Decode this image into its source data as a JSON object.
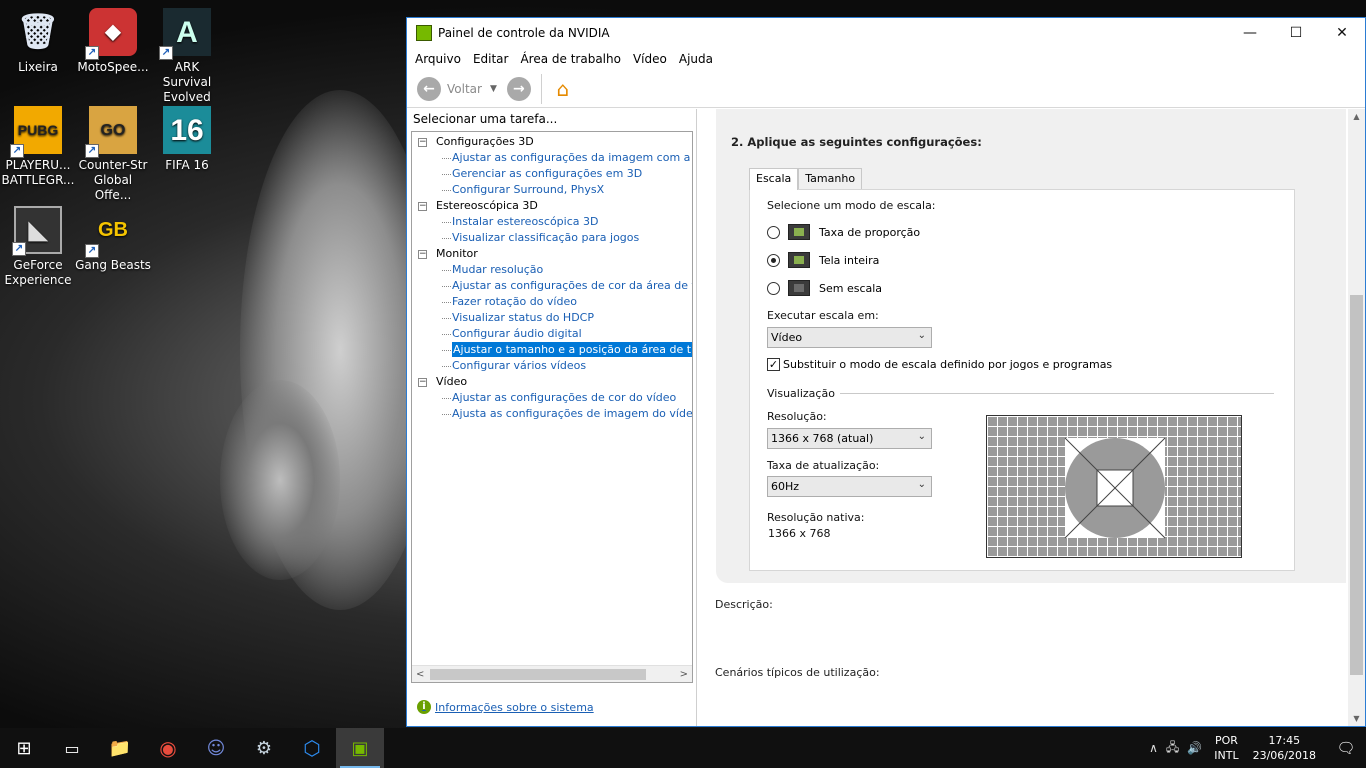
{
  "desktop": {
    "icons": [
      {
        "label": "Lixeira",
        "glyph": "🗑",
        "icon": "recycle-bin-icon"
      },
      {
        "label": "MotoSpee...",
        "glyph": "◆",
        "icon": "motospeed-icon"
      },
      {
        "label": "ARK Survival Evolved",
        "glyph": "A",
        "icon": "ark-icon"
      },
      {
        "label": "PLAYERU... BATTLEGR...",
        "glyph": "PUBG",
        "icon": "pubg-icon"
      },
      {
        "label": "Counter-Str Global Offe...",
        "glyph": "GO",
        "icon": "csgo-icon"
      },
      {
        "label": "FIFA 16",
        "glyph": "16",
        "icon": "fifa-icon"
      },
      {
        "label": "GeForce Experience",
        "glyph": "◣",
        "icon": "geforce-icon"
      },
      {
        "label": "Gang Beasts",
        "glyph": "GB",
        "icon": "gang-beasts-icon"
      }
    ]
  },
  "window": {
    "title": "Painel de controle da NVIDIA",
    "controls": {
      "minimize": "—",
      "maximize": "☐",
      "close": "✕"
    },
    "menu": [
      "Arquivo",
      "Editar",
      "Área de trabalho",
      "Vídeo",
      "Ajuda"
    ],
    "toolbar": {
      "back_label": "Voltar",
      "back_glyph": "←",
      "forward_glyph": "→",
      "dropdown_glyph": "▼",
      "home_glyph": "⌂"
    }
  },
  "left": {
    "header": "Selecionar uma tarefa...",
    "tree": [
      {
        "type": "cat",
        "label": "Configurações 3D"
      },
      {
        "type": "leaf",
        "label": "Ajustar as configurações da imagem com a Visuali:"
      },
      {
        "type": "leaf",
        "label": "Gerenciar as configurações em 3D"
      },
      {
        "type": "leaf",
        "label": "Configurar Surround, PhysX"
      },
      {
        "type": "cat",
        "label": "Estereoscópica 3D"
      },
      {
        "type": "leaf",
        "label": "Instalar estereoscópica 3D"
      },
      {
        "type": "leaf",
        "label": "Visualizar classificação para jogos"
      },
      {
        "type": "cat",
        "label": "Monitor"
      },
      {
        "type": "leaf",
        "label": "Mudar resolução"
      },
      {
        "type": "leaf",
        "label": "Ajustar as configurações de cor da área de trabal"
      },
      {
        "type": "leaf",
        "label": "Fazer rotação do vídeo"
      },
      {
        "type": "leaf",
        "label": "Visualizar status do HDCP"
      },
      {
        "type": "leaf",
        "label": "Configurar áudio digital"
      },
      {
        "type": "leaf",
        "label": "Ajustar o tamanho e a posição da área de trabalh",
        "selected": true
      },
      {
        "type": "leaf",
        "label": "Configurar vários vídeos"
      },
      {
        "type": "cat",
        "label": "Vídeo"
      },
      {
        "type": "leaf",
        "label": "Ajustar as configurações de cor do vídeo"
      },
      {
        "type": "leaf",
        "label": "Ajusta as configurações de imagem do vídeo"
      }
    ],
    "system_info": "Informações sobre o sistema"
  },
  "right": {
    "step_title": "2. Aplique as seguintes configurações:",
    "tabs": {
      "escala": "Escala",
      "tamanho": "Tamanho"
    },
    "scale_mode_label": "Selecione um modo de escala:",
    "radios": {
      "taxa": "Taxa de proporção",
      "tela": "Tela inteira",
      "sem": "Sem escala"
    },
    "selected_radio": "Tela inteira",
    "perform_on_label": "Executar escala em:",
    "perform_on_value": "Vídeo",
    "override_label": "Substituir o modo de escala definido por jogos e programas",
    "override_checked": true,
    "preview_group": "Visualização",
    "resolution_label": "Resolução:",
    "resolution_value": "1366 x 768 (atual)",
    "refresh_label": "Taxa de atualização:",
    "refresh_value": "60Hz",
    "native_label": "Resolução nativa:",
    "native_value": "1366 x 768",
    "description_label": "Descrição:",
    "scenarios_label": "Cenários típicos de utilização:"
  },
  "taskbar": {
    "apps": [
      {
        "icon": "start-icon",
        "glyph": "⊞"
      },
      {
        "icon": "task-view-icon",
        "glyph": "▭"
      },
      {
        "icon": "file-explorer-icon",
        "glyph": "📁"
      },
      {
        "icon": "chrome-icon",
        "glyph": "◉"
      },
      {
        "icon": "discord-icon",
        "glyph": "☺"
      },
      {
        "icon": "steam-icon",
        "glyph": "⚙"
      },
      {
        "icon": "app-cube-icon",
        "glyph": "⬡"
      },
      {
        "icon": "nvidia-icon",
        "glyph": "▣"
      }
    ],
    "tray": {
      "chevron": "∧",
      "network": "🖧",
      "volume": "🔊",
      "lang1": "POR",
      "lang2": "INTL",
      "time": "17:45",
      "date": "23/06/2018",
      "notification": "🗨"
    }
  },
  "colors": {
    "accent": "#0078d7",
    "link": "#1a5fb4",
    "nvidia_green": "#76b900"
  }
}
